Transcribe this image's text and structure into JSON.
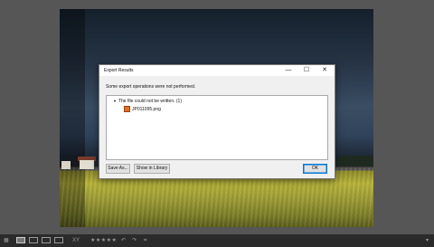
{
  "dialog": {
    "title": "Export Results",
    "minimize_glyph": "—",
    "maximize_glyph": "☐",
    "close_glyph": "✕",
    "message": "Some export operations were not performed.",
    "tree": {
      "group_label": "The file could not be written. (1)",
      "file_name": "JP011095.png"
    },
    "buttons": {
      "save_as": "Save As...",
      "show_in_library": "Show in Library",
      "ok": "OK"
    }
  },
  "toolbar": {
    "grid_icon_glyph": "▦",
    "compare_glyph": "XY",
    "rotate_left_glyph": "↶",
    "rotate_right_glyph": "↷",
    "crop_glyph": "⌗",
    "stars": "★★★★★",
    "menu_glyph": "▾"
  },
  "colors": {
    "accent": "#0078d7",
    "background": "#565656",
    "toolbar": "#2b2b2b"
  }
}
